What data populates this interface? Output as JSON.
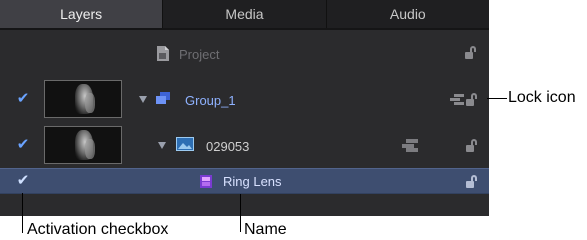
{
  "tabs": [
    {
      "label": "Layers",
      "active": true
    },
    {
      "label": "Media",
      "active": false
    },
    {
      "label": "Audio",
      "active": false
    }
  ],
  "layers": {
    "project": {
      "name": "Project",
      "icon": "project-document-icon"
    },
    "group": {
      "name": "Group_1",
      "checked": true,
      "icon": "group-stack-icon"
    },
    "clip": {
      "name": "029053",
      "checked": true,
      "icon": "image-clip-icon"
    },
    "lens": {
      "name": "Ring Lens",
      "checked": true,
      "selected": true,
      "icon": "filter-icon"
    }
  },
  "callouts": {
    "lock": "Lock icon",
    "checkbox": "Activation checkbox",
    "name": "Name"
  },
  "colors": {
    "panel_bg": "#2b2b2d",
    "selected_row": "#3e4e70",
    "group_text": "#8fb2ff",
    "check": "#6aa3ff"
  }
}
